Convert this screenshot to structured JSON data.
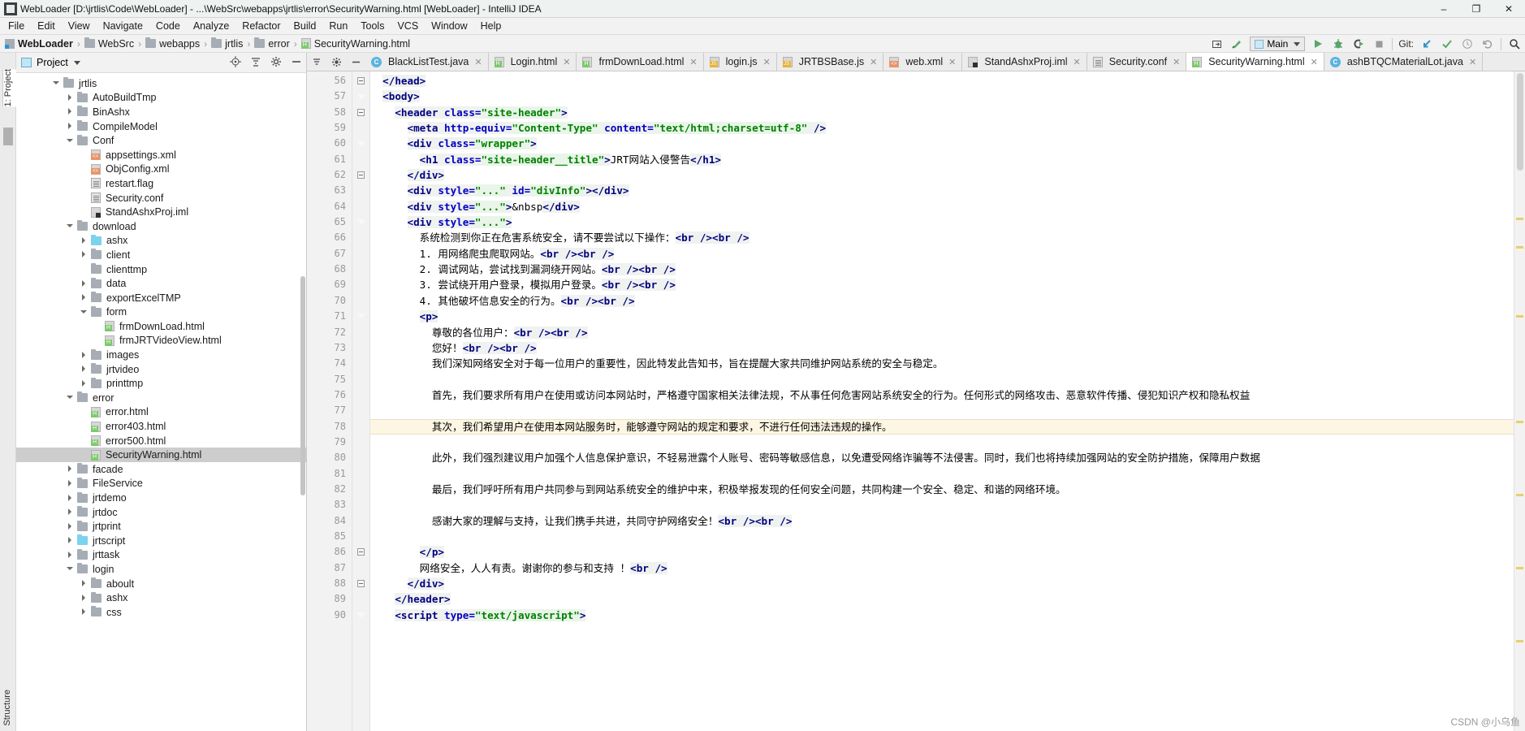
{
  "window": {
    "title": "WebLoader [D:\\jrtlis\\Code\\WebLoader] - ...\\WebSrc\\webapps\\jrtlis\\error\\SecurityWarning.html [WebLoader] - IntelliJ IDEA",
    "minimize": "–",
    "maximize": "❐",
    "close": "✕"
  },
  "menu": [
    "File",
    "Edit",
    "View",
    "Navigate",
    "Code",
    "Analyze",
    "Refactor",
    "Build",
    "Run",
    "Tools",
    "VCS",
    "Window",
    "Help"
  ],
  "breadcrumb": [
    {
      "label": "WebLoader",
      "icon": "module-icon",
      "bold": true
    },
    {
      "label": "WebSrc",
      "icon": "folder-icon",
      "bold": false
    },
    {
      "label": "webapps",
      "icon": "folder-icon",
      "bold": false
    },
    {
      "label": "jrtlis",
      "icon": "folder-icon",
      "bold": false
    },
    {
      "label": "error",
      "icon": "folder-icon",
      "bold": false
    },
    {
      "label": "SecurityWarning.html",
      "icon": "html-file-icon",
      "bold": false
    }
  ],
  "toolbar": {
    "run_config": "Main",
    "git_label": "Git:",
    "icons": [
      "minimize-tool-window-icon",
      "hammer-build-icon",
      "run-icon",
      "debug-icon",
      "run-with-coverage-icon",
      "stop-icon",
      "update-project-icon",
      "commit-icon",
      "history-icon",
      "rollback-icon",
      "search-everywhere-icon"
    ]
  },
  "project_panel": {
    "title": "Project",
    "vertical_label_top": "1: Project",
    "vertical_label_bottom": "Structure",
    "tools": [
      "locate-icon",
      "collapse-all-icon",
      "settings-gear-icon",
      "hide-icon"
    ],
    "tree": [
      {
        "label": "jrtlis",
        "depth": 1,
        "arrow": "down",
        "icon": "folder-icon"
      },
      {
        "label": "AutoBuildTmp",
        "depth": 2,
        "arrow": "right",
        "icon": "folder-icon"
      },
      {
        "label": "BinAshx",
        "depth": 2,
        "arrow": "right",
        "icon": "folder-icon"
      },
      {
        "label": "CompileModel",
        "depth": 2,
        "arrow": "right",
        "icon": "folder-icon"
      },
      {
        "label": "Conf",
        "depth": 2,
        "arrow": "down",
        "icon": "folder-icon"
      },
      {
        "label": "appsettings.xml",
        "depth": 3,
        "arrow": "none",
        "icon": "xml-file-icon"
      },
      {
        "label": "ObjConfig.xml",
        "depth": 3,
        "arrow": "none",
        "icon": "xml-file-icon"
      },
      {
        "label": "restart.flag",
        "depth": 3,
        "arrow": "none",
        "icon": "text-file-icon"
      },
      {
        "label": "Security.conf",
        "depth": 3,
        "arrow": "none",
        "icon": "text-file-icon"
      },
      {
        "label": "StandAshxProj.iml",
        "depth": 3,
        "arrow": "none",
        "icon": "iml-file-icon"
      },
      {
        "label": "download",
        "depth": 2,
        "arrow": "down",
        "icon": "folder-icon"
      },
      {
        "label": "ashx",
        "depth": 3,
        "arrow": "right",
        "icon": "folder-blue-icon"
      },
      {
        "label": "client",
        "depth": 3,
        "arrow": "right",
        "icon": "folder-icon"
      },
      {
        "label": "clienttmp",
        "depth": 3,
        "arrow": "none",
        "icon": "folder-icon"
      },
      {
        "label": "data",
        "depth": 3,
        "arrow": "right",
        "icon": "folder-icon"
      },
      {
        "label": "exportExcelTMP",
        "depth": 3,
        "arrow": "right",
        "icon": "folder-icon"
      },
      {
        "label": "form",
        "depth": 3,
        "arrow": "down",
        "icon": "folder-icon"
      },
      {
        "label": "frmDownLoad.html",
        "depth": 4,
        "arrow": "none",
        "icon": "html-file-icon"
      },
      {
        "label": "frmJRTVideoView.html",
        "depth": 4,
        "arrow": "none",
        "icon": "html-file-icon"
      },
      {
        "label": "images",
        "depth": 3,
        "arrow": "right",
        "icon": "folder-icon"
      },
      {
        "label": "jrtvideo",
        "depth": 3,
        "arrow": "right",
        "icon": "folder-icon"
      },
      {
        "label": "printtmp",
        "depth": 3,
        "arrow": "right",
        "icon": "folder-icon"
      },
      {
        "label": "error",
        "depth": 2,
        "arrow": "down",
        "icon": "folder-icon"
      },
      {
        "label": "error.html",
        "depth": 3,
        "arrow": "none",
        "icon": "html-file-icon"
      },
      {
        "label": "error403.html",
        "depth": 3,
        "arrow": "none",
        "icon": "html-file-icon"
      },
      {
        "label": "error500.html",
        "depth": 3,
        "arrow": "none",
        "icon": "html-file-icon"
      },
      {
        "label": "SecurityWarning.html",
        "depth": 3,
        "arrow": "none",
        "icon": "html-file-icon",
        "selected": true
      },
      {
        "label": "facade",
        "depth": 2,
        "arrow": "right",
        "icon": "folder-icon"
      },
      {
        "label": "FileService",
        "depth": 2,
        "arrow": "right",
        "icon": "folder-icon"
      },
      {
        "label": "jrtdemo",
        "depth": 2,
        "arrow": "right",
        "icon": "folder-icon"
      },
      {
        "label": "jrtdoc",
        "depth": 2,
        "arrow": "right",
        "icon": "folder-icon"
      },
      {
        "label": "jrtprint",
        "depth": 2,
        "arrow": "right",
        "icon": "folder-icon"
      },
      {
        "label": "jrtscript",
        "depth": 2,
        "arrow": "right",
        "icon": "folder-blue-icon"
      },
      {
        "label": "jrttask",
        "depth": 2,
        "arrow": "right",
        "icon": "folder-icon"
      },
      {
        "label": "login",
        "depth": 2,
        "arrow": "down",
        "icon": "folder-icon"
      },
      {
        "label": "aboult",
        "depth": 3,
        "arrow": "right",
        "icon": "folder-icon"
      },
      {
        "label": "ashx",
        "depth": 3,
        "arrow": "right",
        "icon": "folder-icon"
      },
      {
        "label": "css",
        "depth": 3,
        "arrow": "right",
        "icon": "folder-icon"
      }
    ]
  },
  "editor_tabs": [
    {
      "label": "BlackListTest.java",
      "icon": "java-file-icon",
      "active": false
    },
    {
      "label": "Login.html",
      "icon": "html-file-icon",
      "active": false
    },
    {
      "label": "frmDownLoad.html",
      "icon": "html-file-icon",
      "active": false
    },
    {
      "label": "login.js",
      "icon": "js-file-icon",
      "active": false
    },
    {
      "label": "JRTBSBase.js",
      "icon": "js-file-icon",
      "active": false
    },
    {
      "label": "web.xml",
      "icon": "xml-file-icon",
      "active": false
    },
    {
      "label": "StandAshxProj.iml",
      "icon": "iml-file-icon",
      "active": false
    },
    {
      "label": "Security.conf",
      "icon": "text-file-icon",
      "active": false
    },
    {
      "label": "SecurityWarning.html",
      "icon": "html-file-icon",
      "active": true
    },
    {
      "label": "ashBTQCMaterialLot.java",
      "icon": "java-file-icon",
      "active": false
    }
  ],
  "code": {
    "first_line_number": 56,
    "highlighted_line": 78,
    "lines": [
      {
        "n": 56,
        "indent": 2,
        "fold": "square",
        "parts": [
          {
            "t": "</head>",
            "c": "tg",
            "bg": true
          }
        ]
      },
      {
        "n": 57,
        "indent": 2,
        "fold": "tri",
        "parts": [
          {
            "t": "<body>",
            "c": "tg",
            "bg": true
          }
        ]
      },
      {
        "n": 58,
        "indent": 4,
        "fold": "square",
        "parts": [
          {
            "t": "<header ",
            "c": "tg",
            "bg": true
          },
          {
            "t": "class=",
            "c": "at",
            "bg": true
          },
          {
            "t": "\"site-header\"",
            "c": "va",
            "bg": true
          },
          {
            "t": ">",
            "c": "tg",
            "bg": true
          }
        ]
      },
      {
        "n": 59,
        "indent": 6,
        "fold": "",
        "parts": [
          {
            "t": "<meta ",
            "c": "tg",
            "bg": true
          },
          {
            "t": "http-equiv=",
            "c": "at",
            "bg": true
          },
          {
            "t": "\"Content-Type\"",
            "c": "va",
            "bg": true
          },
          {
            "t": " content=",
            "c": "at",
            "bg": true
          },
          {
            "t": "\"text/html;charset=utf-8\"",
            "c": "va",
            "bg": true
          },
          {
            "t": " />",
            "c": "tg",
            "bg": true
          }
        ]
      },
      {
        "n": 60,
        "indent": 6,
        "fold": "tri",
        "parts": [
          {
            "t": "<div ",
            "c": "tg",
            "bg": true
          },
          {
            "t": "class=",
            "c": "at",
            "bg": true
          },
          {
            "t": "\"wrapper\"",
            "c": "va",
            "bg": true
          },
          {
            "t": ">",
            "c": "tg",
            "bg": true
          }
        ]
      },
      {
        "n": 61,
        "indent": 8,
        "fold": "",
        "parts": [
          {
            "t": "<h1 ",
            "c": "tg",
            "bg": true
          },
          {
            "t": "class=",
            "c": "at",
            "bg": true
          },
          {
            "t": "\"site-header__title\"",
            "c": "va",
            "bg": true
          },
          {
            "t": ">",
            "c": "tg",
            "bg": true
          },
          {
            "t": "JRT网站入侵警告",
            "c": "tx",
            "bg": false
          },
          {
            "t": "</h1>",
            "c": "tg",
            "bg": true
          }
        ]
      },
      {
        "n": 62,
        "indent": 6,
        "fold": "square",
        "parts": [
          {
            "t": "</div>",
            "c": "tg",
            "bg": true
          }
        ]
      },
      {
        "n": 63,
        "indent": 6,
        "fold": "",
        "parts": [
          {
            "t": "<div ",
            "c": "tg",
            "bg": true
          },
          {
            "t": "style=",
            "c": "at",
            "bg": true
          },
          {
            "t": "\"...\"",
            "c": "va",
            "bg": true
          },
          {
            "t": " id=",
            "c": "at",
            "bg": true
          },
          {
            "t": "\"divInfo\"",
            "c": "va",
            "bg": true
          },
          {
            "t": "></div>",
            "c": "tg",
            "bg": true
          }
        ]
      },
      {
        "n": 64,
        "indent": 6,
        "fold": "",
        "parts": [
          {
            "t": "<div ",
            "c": "tg",
            "bg": true
          },
          {
            "t": "style=",
            "c": "at",
            "bg": true
          },
          {
            "t": "\"...\"",
            "c": "va",
            "bg": true
          },
          {
            "t": ">",
            "c": "tg",
            "bg": true
          },
          {
            "t": "&nbsp",
            "c": "tx",
            "bg": false
          },
          {
            "t": "</div>",
            "c": "tg",
            "bg": true
          }
        ]
      },
      {
        "n": 65,
        "indent": 6,
        "fold": "tri",
        "parts": [
          {
            "t": "<div ",
            "c": "tg",
            "bg": true
          },
          {
            "t": "style=",
            "c": "at",
            "bg": true
          },
          {
            "t": "\"...\"",
            "c": "va",
            "bg": true
          },
          {
            "t": ">",
            "c": "tg",
            "bg": true
          }
        ]
      },
      {
        "n": 66,
        "indent": 8,
        "fold": "",
        "parts": [
          {
            "t": "系统检测到你正在危害系统安全，请不要尝试以下操作：",
            "c": "tx",
            "bg": false
          },
          {
            "t": "<br /><br />",
            "c": "tg",
            "bg": true
          }
        ]
      },
      {
        "n": 67,
        "indent": 8,
        "fold": "",
        "parts": [
          {
            "t": "1. 用网络爬虫爬取网站。",
            "c": "tx",
            "bg": false
          },
          {
            "t": "<br /><br />",
            "c": "tg",
            "bg": true
          }
        ]
      },
      {
        "n": 68,
        "indent": 8,
        "fold": "",
        "parts": [
          {
            "t": "2. 调试网站，尝试找到漏洞绕开网站。",
            "c": "tx",
            "bg": false
          },
          {
            "t": "<br /><br />",
            "c": "tg",
            "bg": true
          }
        ]
      },
      {
        "n": 69,
        "indent": 8,
        "fold": "",
        "parts": [
          {
            "t": "3. 尝试绕开用户登录，模拟用户登录。",
            "c": "tx",
            "bg": false
          },
          {
            "t": "<br /><br />",
            "c": "tg",
            "bg": true
          }
        ]
      },
      {
        "n": 70,
        "indent": 8,
        "fold": "",
        "parts": [
          {
            "t": "4. 其他破坏信息安全的行为。",
            "c": "tx",
            "bg": false
          },
          {
            "t": "<br /><br />",
            "c": "tg",
            "bg": true
          }
        ]
      },
      {
        "n": 71,
        "indent": 8,
        "fold": "tri",
        "parts": [
          {
            "t": "<p>",
            "c": "tg",
            "bg": true
          }
        ]
      },
      {
        "n": 72,
        "indent": 10,
        "fold": "",
        "parts": [
          {
            "t": "尊敬的各位用户：",
            "c": "tx",
            "bg": false
          },
          {
            "t": "<br /><br />",
            "c": "tg",
            "bg": true
          }
        ]
      },
      {
        "n": 73,
        "indent": 10,
        "fold": "",
        "parts": [
          {
            "t": "您好！",
            "c": "tx",
            "bg": false
          },
          {
            "t": "<br /><br />",
            "c": "tg",
            "bg": true
          }
        ]
      },
      {
        "n": 74,
        "indent": 10,
        "fold": "",
        "parts": [
          {
            "t": "我们深知网络安全对于每一位用户的重要性，因此特发此告知书，旨在提醒大家共同维护网站系统的安全与稳定。",
            "c": "tx",
            "bg": false
          }
        ]
      },
      {
        "n": 75,
        "indent": 0,
        "fold": "",
        "parts": []
      },
      {
        "n": 76,
        "indent": 10,
        "fold": "",
        "parts": [
          {
            "t": "首先，我们要求所有用户在使用或访问本网站时，严格遵守国家相关法律法规，不从事任何危害网站系统安全的行为。任何形式的网络攻击、恶意软件传播、侵犯知识产权和隐私权益",
            "c": "tx",
            "bg": false
          }
        ]
      },
      {
        "n": 77,
        "indent": 0,
        "fold": "",
        "parts": []
      },
      {
        "n": 78,
        "indent": 10,
        "fold": "",
        "parts": [
          {
            "t": "其次，我们希望用户在使用本网站服务时，能够遵守网站的规定和要求，不进行任何违法违规的操作。",
            "c": "tx",
            "bg": false
          }
        ]
      },
      {
        "n": 79,
        "indent": 0,
        "fold": "",
        "parts": []
      },
      {
        "n": 80,
        "indent": 10,
        "fold": "",
        "parts": [
          {
            "t": "此外，我们强烈建议用户加强个人信息保护意识，不轻易泄露个人账号、密码等敏感信息，以免遭受网络诈骗等不法侵害。同时，我们也将持续加强网站的安全防护措施，保障用户数据",
            "c": "tx",
            "bg": false
          }
        ]
      },
      {
        "n": 81,
        "indent": 0,
        "fold": "",
        "parts": []
      },
      {
        "n": 82,
        "indent": 10,
        "fold": "",
        "parts": [
          {
            "t": "最后，我们呼吁所有用户共同参与到网站系统安全的维护中来，积极举报发现的任何安全问题，共同构建一个安全、稳定、和谐的网络环境。",
            "c": "tx",
            "bg": false
          }
        ]
      },
      {
        "n": 83,
        "indent": 0,
        "fold": "",
        "parts": []
      },
      {
        "n": 84,
        "indent": 10,
        "fold": "",
        "parts": [
          {
            "t": "感谢大家的理解与支持，让我们携手共进，共同守护网络安全！",
            "c": "tx",
            "bg": false
          },
          {
            "t": "<br /><br />",
            "c": "tg",
            "bg": true
          }
        ]
      },
      {
        "n": 85,
        "indent": 0,
        "fold": "",
        "parts": []
      },
      {
        "n": 86,
        "indent": 8,
        "fold": "square",
        "parts": [
          {
            "t": "</p>",
            "c": "tg",
            "bg": true
          }
        ]
      },
      {
        "n": 87,
        "indent": 8,
        "fold": "",
        "parts": [
          {
            "t": "网络安全，人人有责。谢谢你的参与和支持 ！",
            "c": "tx",
            "bg": false
          },
          {
            "t": "<br />",
            "c": "tg",
            "bg": true
          }
        ]
      },
      {
        "n": 88,
        "indent": 6,
        "fold": "square",
        "parts": [
          {
            "t": "</div>",
            "c": "tg",
            "bg": true
          }
        ]
      },
      {
        "n": 89,
        "indent": 4,
        "fold": "",
        "parts": [
          {
            "t": "</header>",
            "c": "tg",
            "bg": true
          }
        ]
      },
      {
        "n": 90,
        "indent": 4,
        "fold": "tri",
        "parts": [
          {
            "t": "<script ",
            "c": "tg",
            "bg": true
          },
          {
            "t": "type=",
            "c": "at",
            "bg": true
          },
          {
            "t": "\"text/javascript\"",
            "c": "va",
            "bg": true
          },
          {
            "t": ">",
            "c": "tg",
            "bg": true
          }
        ]
      }
    ]
  },
  "watermark": "CSDN @小乌鱼",
  "colors": {
    "tag": "#000080",
    "attr": "#0000c0",
    "value": "#008000",
    "highlight": "#fdf6e3",
    "selection": "#cdcdcd"
  }
}
